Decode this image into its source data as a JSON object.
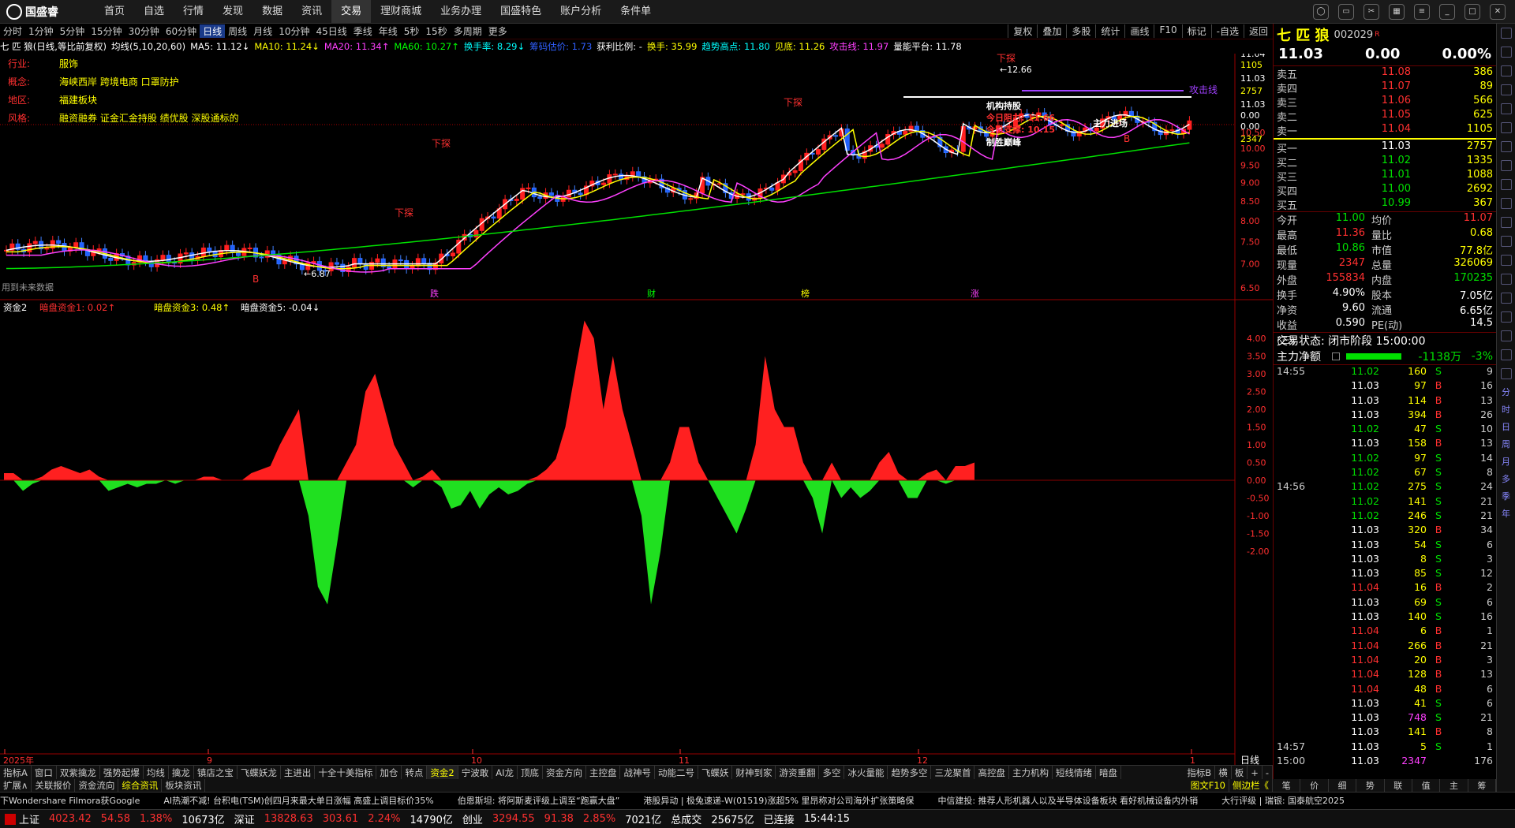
{
  "app": {
    "logo": "国盛睿"
  },
  "topmenu": [
    "首页",
    "自选",
    "行情",
    "发现",
    "数据",
    "资讯",
    "交易",
    "理财商城",
    "业务办理",
    "国盛特色",
    "账户分析",
    "条件单"
  ],
  "topmenu_active": 6,
  "periods": [
    "分时",
    "1分钟",
    "5分钟",
    "15分钟",
    "30分钟",
    "60分钟",
    "日线",
    "周线",
    "月线",
    "10分钟",
    "45日线",
    "季线",
    "年线",
    "5秒",
    "15秒",
    "多周期",
    "更多"
  ],
  "periods_active": 6,
  "period_right": [
    "复权",
    "叠加",
    "多股",
    "统计",
    "画线",
    "F10",
    "标记",
    "-自选",
    "返回"
  ],
  "info": [
    {
      "t": "七 匹 狼(日线,等比前复权)",
      "c": "#fff"
    },
    {
      "t": "均线(5,10,20,60)",
      "c": "#fff"
    },
    {
      "t": "MA5: 11.12↓",
      "c": "#fff"
    },
    {
      "t": "MA10: 11.24↓",
      "c": "#ffff00"
    },
    {
      "t": "MA20: 11.34↑",
      "c": "#ff40ff"
    },
    {
      "t": "MA60: 10.27↑",
      "c": "#00ff00"
    },
    {
      "t": "换手率: 8.29↓",
      "c": "#00ffff"
    },
    {
      "t": "筹码估价: 1.73",
      "c": "#3060ff"
    },
    {
      "t": "获利比例: -",
      "c": "#fff"
    },
    {
      "t": "换手: 35.99",
      "c": "#ffff00"
    },
    {
      "t": "趋势高点: 11.80",
      "c": "#00ffff"
    },
    {
      "t": "见底: 11.26",
      "c": "#ffff00"
    },
    {
      "t": "攻击线: 11.97",
      "c": "#ff40ff"
    },
    {
      "t": "量能平台: 11.78",
      "c": "#fff"
    }
  ],
  "tags": [
    {
      "k": "行业:",
      "v": "服饰"
    },
    {
      "k": "概念:",
      "v": "海峡西岸 跨境电商 口罩防护"
    },
    {
      "k": "地区:",
      "v": "福建板块"
    },
    {
      "k": "风格:",
      "v": "融资融券 证金汇金持股 绩优股 深股通标的"
    }
  ],
  "sub_info": [
    {
      "t": "资金2",
      "c": "#fff"
    },
    {
      "t": "暗盘资金1: 0.02↑",
      "c": "#ff3030"
    },
    {
      "t": "暗盘资金3: 0.48↑",
      "c": "#ffff00"
    },
    {
      "t": "暗盘资金5: -0.04↓",
      "c": "#fff"
    }
  ],
  "chart_labels": {
    "xia_tan": "下探",
    "peak_val": "12.66",
    "low_val": "6.87",
    "future": "用到未来数据",
    "attack": "攻击线",
    "jia_label": "J",
    "z_labels": [
      "跌",
      "财",
      "榜",
      "涨"
    ],
    "box_texts": [
      "机构持股",
      "今日阻力: 11.66",
      "今日支撑: 10.15",
      "制胜巅峰",
      "主力进场"
    ],
    "b_label": "B"
  },
  "chart_data": [
    {
      "type": "candlestick",
      "title": "七 匹 狼(日线,等比前复权)",
      "y_ticks": [
        6.5,
        7.0,
        7.5,
        8.0,
        8.5,
        9.0,
        9.5,
        10.0,
        10.5,
        11.03
      ],
      "right_ticks_top": [
        "11.04",
        "1105",
        "11.03",
        "2757",
        "11.03",
        "0.00",
        "0.00",
        "2347"
      ],
      "x_ticks": [
        "2025年",
        "9",
        "10",
        "11",
        "12",
        "1"
      ],
      "series": [
        {
          "name": "MA5",
          "value": 11.12
        },
        {
          "name": "MA10",
          "value": 11.24
        },
        {
          "name": "MA20",
          "value": 11.34
        },
        {
          "name": "MA60",
          "value": 10.27
        }
      ]
    },
    {
      "type": "area",
      "title": "资金2",
      "y_ticks": [
        "4.00",
        "3.50",
        "3.00",
        "2.50",
        "2.00",
        "1.50",
        "1.00",
        "0.50",
        "0.00",
        "-0.50",
        "-1.00",
        "-1.50",
        "-2.00"
      ],
      "values": [
        0.2,
        0.2,
        -0.3,
        -0.1,
        0.1,
        0.3,
        0.4,
        0.3,
        0.2,
        0.3,
        0.1,
        -0.3,
        -0.2,
        -0.1,
        -0.2,
        -0.1,
        -0.1,
        0.0,
        -0.1,
        0.0,
        0.0,
        0.1,
        0.1,
        0.0,
        0.0,
        0.0,
        0.2,
        0.3,
        0.4,
        1.0,
        1.5,
        2.0,
        -1.0,
        -3.0,
        -3.5,
        -1.8,
        0.5,
        1.0,
        2.5,
        3.0,
        2.0,
        1.0,
        0.5,
        -0.2,
        0.1,
        0.3,
        -0.2,
        -0.8,
        -0.7,
        -0.3,
        -0.8,
        -0.4,
        -0.2,
        -0.4,
        -0.3,
        -0.1,
        0.1,
        0.3,
        0.6,
        1.5,
        3.0,
        4.5,
        4.0,
        2.0,
        3.5,
        2.0,
        1.0,
        -1.0,
        -3.5,
        -2.0,
        0.5,
        1.5,
        1.5,
        0.5,
        0.0,
        -0.5,
        -1.0,
        -1.5,
        -0.8,
        1.0,
        3.5,
        2.0,
        1.5,
        1.5,
        0.5,
        -0.5,
        -1.5,
        0.5,
        -0.5,
        -0.2,
        -0.5,
        -0.3,
        0.5,
        0.8,
        0.2,
        -0.5,
        -0.5,
        0.2,
        0.3,
        -0.1,
        0.4,
        0.4,
        0.5
      ]
    }
  ],
  "rp": {
    "name": "七 匹 狼",
    "code": "002029",
    "r": "R",
    "price": "11.03",
    "chg": "0.00",
    "pct": "0.00%",
    "asks": [
      [
        "卖五",
        "11.08",
        "386"
      ],
      [
        "卖四",
        "11.07",
        "89"
      ],
      [
        "卖三",
        "11.06",
        "566"
      ],
      [
        "卖二",
        "11.05",
        "625"
      ],
      [
        "卖一",
        "11.04",
        "1105"
      ]
    ],
    "bids": [
      [
        "买一",
        "11.03",
        "2757"
      ],
      [
        "买二",
        "11.02",
        "1335"
      ],
      [
        "买三",
        "11.01",
        "1088"
      ],
      [
        "买四",
        "11.00",
        "2692"
      ],
      [
        "买五",
        "10.99",
        "367"
      ]
    ],
    "stats": [
      [
        "今开",
        "11.00",
        "均价",
        "11.07"
      ],
      [
        "最高",
        "11.36",
        "量比",
        "0.68"
      ],
      [
        "最低",
        "10.86",
        "市值",
        "77.8亿"
      ],
      [
        "现量",
        "2347",
        "总量",
        "326069"
      ],
      [
        "外盘",
        "155834",
        "内盘",
        "170235"
      ],
      [
        "换手",
        "4.90%",
        "股本",
        "7.05亿"
      ],
      [
        "净资",
        "9.60",
        "流通",
        "6.65亿"
      ],
      [
        "收益(三)",
        "0.590",
        "PE(动)",
        "14.5"
      ]
    ],
    "trade_state": "交易状态: 闭市阶段 15:00:00",
    "mainflow_label": "主力净额",
    "mainflow_val": "-1138万",
    "mainflow_pct": "-3%",
    "ticks": [
      [
        "14:55",
        "11.02",
        "160",
        "S",
        "9"
      ],
      [
        "",
        "11.03",
        "97",
        "B",
        "16"
      ],
      [
        "",
        "11.03",
        "114",
        "B",
        "13"
      ],
      [
        "",
        "11.03",
        "394",
        "B",
        "26"
      ],
      [
        "",
        "11.02",
        "47",
        "S",
        "10"
      ],
      [
        "",
        "11.03",
        "158",
        "B",
        "13"
      ],
      [
        "",
        "11.02",
        "97",
        "S",
        "14"
      ],
      [
        "",
        "11.02",
        "67",
        "S",
        "8"
      ],
      [
        "14:56",
        "11.02",
        "275",
        "S",
        "24"
      ],
      [
        "",
        "11.02",
        "141",
        "S",
        "21"
      ],
      [
        "",
        "11.02",
        "246",
        "S",
        "21"
      ],
      [
        "",
        "11.03",
        "320",
        "B",
        "34"
      ],
      [
        "",
        "11.03",
        "54",
        "S",
        "6"
      ],
      [
        "",
        "11.03",
        "8",
        "S",
        "3"
      ],
      [
        "",
        "11.03",
        "85",
        "S",
        "12"
      ],
      [
        "",
        "11.04",
        "16",
        "B",
        "2"
      ],
      [
        "",
        "11.03",
        "69",
        "S",
        "6"
      ],
      [
        "",
        "11.03",
        "140",
        "S",
        "16"
      ],
      [
        "",
        "11.04",
        "6",
        "B",
        "1"
      ],
      [
        "",
        "11.04",
        "266",
        "B",
        "21"
      ],
      [
        "",
        "11.04",
        "20",
        "B",
        "3"
      ],
      [
        "",
        "11.04",
        "128",
        "B",
        "13"
      ],
      [
        "",
        "11.04",
        "48",
        "B",
        "6"
      ],
      [
        "",
        "11.03",
        "41",
        "S",
        "6"
      ],
      [
        "",
        "11.03",
        "748",
        "S",
        "21"
      ],
      [
        "",
        "11.03",
        "141",
        "B",
        "8"
      ],
      [
        "14:57",
        "11.03",
        "5",
        "S",
        "1"
      ],
      [
        "15:00",
        "11.03",
        "2347",
        "",
        "176"
      ]
    ]
  },
  "sidebar": [
    "分",
    "时",
    "日",
    "周",
    "月",
    "多",
    "季",
    "年"
  ],
  "bottomtabs": [
    "指标A",
    "窗口",
    "双紫擒龙",
    "强势起爆",
    "均线",
    "擒龙",
    "镇店之宝",
    "飞蝶妖龙",
    "主进出",
    "十全十美指标",
    "加仓",
    "转点",
    "资金2",
    "宁波敢",
    "AI龙",
    "顶底",
    "资金方向",
    "主控盘",
    "战神号",
    "动能二号",
    "飞蝶妖",
    "财神到家",
    "游资重翻",
    "多空",
    "冰火量能",
    "趋势多空",
    "三龙聚首",
    "高控盘",
    "主力机构",
    "短线情绪",
    "暗盘"
  ],
  "bottomtabs_active": 12,
  "bottomtabs_right": [
    "指标B",
    "横",
    "板",
    "+",
    "-"
  ],
  "bottomtabs2": [
    "扩展∧",
    "关联报价",
    "资金流向",
    "综合资讯",
    "板块资讯"
  ],
  "bottomtabs2_active": 3,
  "bottomtabs2_right": [
    "图文F10",
    "侧边栏《"
  ],
  "rp_tabs": [
    "笔",
    "价",
    "细",
    "势",
    "联",
    "值",
    "主",
    "筹"
  ],
  "news": [
    "下Wondershare Filmora获Google",
    "AI热潮不减! 台积电(TSM)创四月来最大单日涨幅 高盛上调目标价35%",
    "伯恩斯坦: 将阿斯麦评级上调至“跑赢大盘”",
    "港股异动 | 极兔速递-W(01519)涨超5% 里昂称对公司海外扩张策略保",
    "中信建投: 推荐人形机器人以及半导体设备板块 看好机械设备内外销",
    "大行评级 | 瑞银: 国泰航空2025"
  ],
  "status": [
    {
      "t": "上证",
      "c": "#fff"
    },
    {
      "t": "4023.42",
      "c": "#ff3030"
    },
    {
      "t": "54.58",
      "c": "#ff3030"
    },
    {
      "t": "1.38%",
      "c": "#ff3030"
    },
    {
      "t": "10673亿",
      "c": "#fff"
    },
    {
      "t": "深证",
      "c": "#fff"
    },
    {
      "t": "13828.63",
      "c": "#ff3030"
    },
    {
      "t": "303.61",
      "c": "#ff3030"
    },
    {
      "t": "2.24%",
      "c": "#ff3030"
    },
    {
      "t": "14790亿",
      "c": "#fff"
    },
    {
      "t": "创业",
      "c": "#fff"
    },
    {
      "t": "3294.55",
      "c": "#ff3030"
    },
    {
      "t": "91.38",
      "c": "#ff3030"
    },
    {
      "t": "2.85%",
      "c": "#ff3030"
    },
    {
      "t": "7021亿",
      "c": "#fff"
    },
    {
      "t": "总成交",
      "c": "#fff"
    },
    {
      "t": "25675亿",
      "c": "#fff"
    },
    {
      "t": "已连接",
      "c": "#fff"
    },
    {
      "t": "15:44:15",
      "c": "#fff"
    }
  ],
  "period_label": "日线"
}
